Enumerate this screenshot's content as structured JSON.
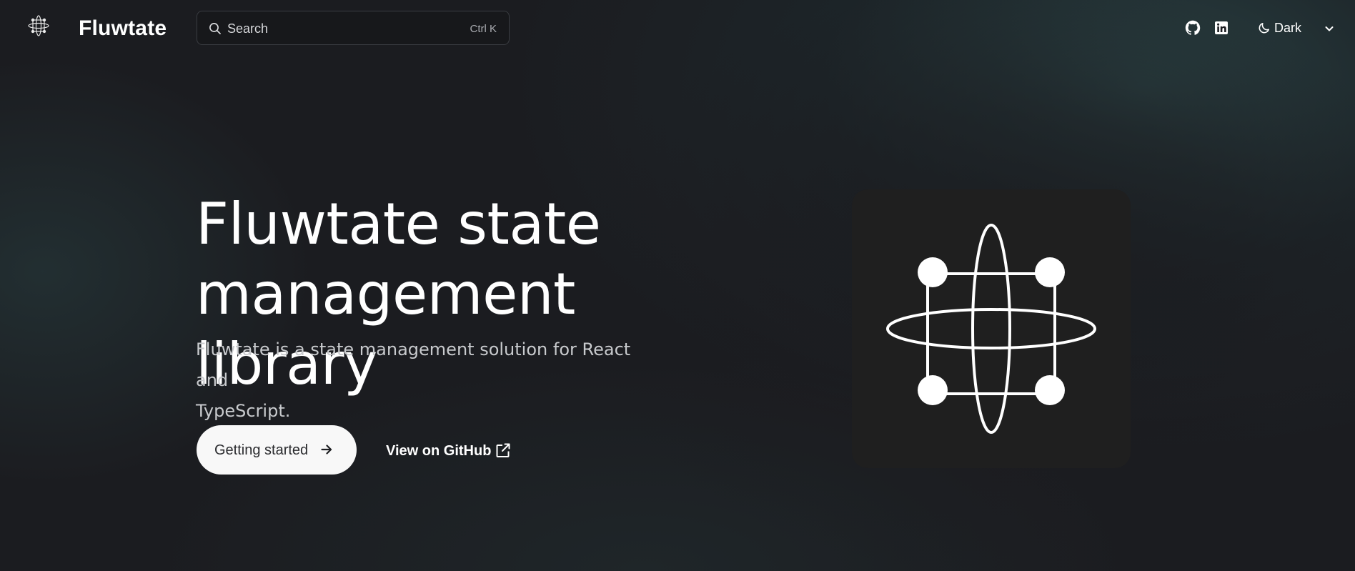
{
  "header": {
    "logo_icon": "fluwtate-logo-icon",
    "brand": "Fluwtate",
    "search": {
      "placeholder": "Search",
      "shortcut": "Ctrl K",
      "icon": "search-icon"
    },
    "social": [
      {
        "name": "GitHub",
        "icon": "github-icon"
      },
      {
        "name": "LinkedIn",
        "icon": "linkedin-icon"
      }
    ],
    "theme": {
      "selected": "Dark",
      "icon": "moon-icon",
      "dropdown_icon": "chevron-down-icon"
    }
  },
  "hero": {
    "title_line1": "Fluwtate state",
    "title_line2": "management library",
    "description_line1": "Fluwtate is a state management solution for React and",
    "description_line2": "TypeScript.",
    "primary_button": {
      "label": "Getting started",
      "icon": "arrow-right-icon"
    },
    "secondary_button": {
      "label": "View on GitHub",
      "icon": "external-link-icon"
    }
  },
  "illustration": {
    "icon": "fluwtate-logo-illustration",
    "colors": {
      "card": "#1f1f1f",
      "stroke": "#ffffff"
    }
  },
  "colors": {
    "background": "#1b1c20",
    "accent_glow": "#2c4648",
    "primary_button_bg": "#f8f8f8",
    "primary_button_text": "#2a2b2e",
    "muted_text": "#c8cacd"
  }
}
